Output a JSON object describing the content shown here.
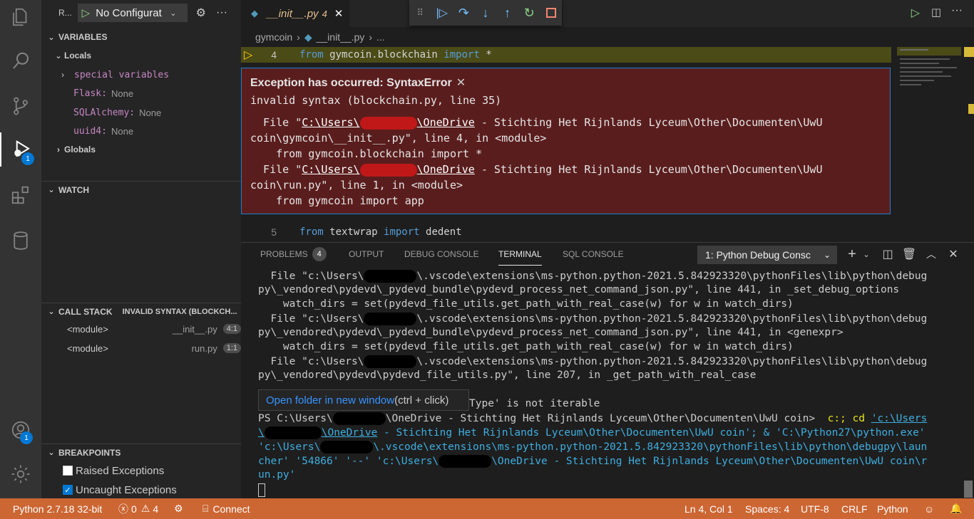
{
  "activity_bar": {
    "debug_badge": "1",
    "accounts_badge": "1"
  },
  "sidebar": {
    "run_label": "R...",
    "config_select": "No Configurat",
    "variables_header": "VARIABLES",
    "locals_label": "Locals",
    "locals_items": [
      {
        "name": "special variables",
        "value": ""
      },
      {
        "name": "Flask:",
        "value": "None"
      },
      {
        "name": "SQLAlchemy:",
        "value": "None"
      },
      {
        "name": "uuid4:",
        "value": "None"
      }
    ],
    "globals_label": "Globals",
    "watch_header": "WATCH",
    "callstack_header": "CALL STACK",
    "callstack_status": "INVALID SYNTAX (BLOCKCH...",
    "callstack_items": [
      {
        "name": "<module>",
        "file": "__init__.py",
        "pos": "4:1"
      },
      {
        "name": "<module>",
        "file": "run.py",
        "pos": "1:1"
      }
    ],
    "breakpoints_header": "BREAKPOINTS",
    "breakpoints": [
      {
        "label": "Raised Exceptions",
        "checked": false
      },
      {
        "label": "Uncaught Exceptions",
        "checked": true
      }
    ]
  },
  "editor": {
    "tab_label": "__init__.py",
    "tab_badge": "4",
    "breadcrumb": {
      "folder": "gymcoin",
      "file": "__init__.py",
      "tail": "..."
    },
    "line4": {
      "num": "4",
      "kw1": "from",
      "mod": " gymcoin.blockchain ",
      "kw2": "import",
      "rest": " *"
    },
    "line5": {
      "num": "5",
      "kw1": "from",
      "mod": " textwrap ",
      "kw2": "import",
      "rest": " dedent"
    },
    "exception": {
      "title": "Exception has occurred: SyntaxError",
      "message": "invalid syntax (blockchain.py, line 35)",
      "tb1_prefix": "  File \"",
      "tb1_link_a": "C:\\Users\\",
      "tb1_link_b": "\\OneDrive",
      "tb1_rest": " - Stichting Het Rijnlands Lyceum\\Other\\Documenten\\UwU",
      "tb1_line2": "coin\\gymcoin\\__init__.py\", line 4, in <module>",
      "tb1_code": "    from gymcoin.blockchain import *",
      "tb2_prefix": "  File \"",
      "tb2_link_a": "C:\\Users\\",
      "tb2_link_b": "\\OneDrive",
      "tb2_rest": " - Stichting Het Rijnlands Lyceum\\Other\\Documenten\\UwU",
      "tb2_line2": "coin\\run.py\", line 1, in <module>",
      "tb2_code": "    from gymcoin import app"
    }
  },
  "panel": {
    "tabs": [
      "PROBLEMS",
      "OUTPUT",
      "DEBUG CONSOLE",
      "TERMINAL",
      "SQL CONSOLE"
    ],
    "problems_badge": "4",
    "terminal_select": "1: Python Debug Consc",
    "terminal_lines": {
      "l1a": "  File \"c:\\Users\\",
      "l1b": "\\.vscode\\extensions\\ms-python.python-2021.5.842923320\\pythonFiles\\lib\\python\\debug",
      "l2": "py\\_vendored\\pydevd\\_pydevd_bundle\\pydevd_process_net_command_json.py\", line 441, in _set_debug_options",
      "l3": "    watch_dirs = set(pydevd_file_utils.get_path_with_real_case(w) for w in watch_dirs)",
      "l4a": "  File \"c:\\Users\\",
      "l4b": "\\.vscode\\extensions\\ms-python.python-2021.5.842923320\\pythonFiles\\lib\\python\\debug",
      "l5": "py\\_vendored\\pydevd\\_pydevd_bundle\\pydevd_process_net_command_json.py\", line 441, in <genexpr>",
      "l6": "    watch_dirs = set(pydevd_file_utils.get_path_with_real_case(w) for w in watch_dirs)",
      "l7a": "  File \"c:\\Users\\",
      "l7b": "\\.vscode\\extensions\\ms-python.python-2021.5.842923320\\pythonFiles\\lib\\python\\debug",
      "l8": "py\\_vendored\\pydevd\\pydevd_file_utils.py\", line 207, in _get_path_with_real_case",
      "l10": "Type' is not iterable",
      "ps_a": "PS C:\\Users\\",
      "ps_b": "\\OneDrive - Stichting Het Rijnlands Lyceum\\Other\\Documenten\\UwU coin> ",
      "ps_cmd": " c:; cd ",
      "ps_link": "'c:\\Users",
      "l12_link": "\\OneDrive",
      "l12_rest": " - Stichting Het Rijnlands Lyceum\\Other\\Documenten\\UwU coin'; & 'C:\\Python27\\python.exe'",
      "l13a": "'c:\\Users\\",
      "l13b": "\\.vscode\\extensions\\ms-python.python-2021.5.842923320\\pythonFiles\\lib\\python\\debugpy\\laun",
      "l14a": "cher' '54866' '--' 'c:\\Users\\",
      "l14b": "\\OneDrive - Stichting Het Rijnlands Lyceum\\Other\\Documenten\\UwU coin\\r",
      "l15": "un.py'"
    },
    "tooltip_link": "Open folder in new window",
    "tooltip_hint": " (ctrl + click)"
  },
  "status": {
    "python": "Python 2.7.18 32-bit",
    "errors": "0",
    "warnings": "4",
    "connect": "Connect",
    "position": "Ln 4, Col 1",
    "spaces": "Spaces: 4",
    "encoding": "UTF-8",
    "eol": "CRLF",
    "language": "Python"
  },
  "colors": {
    "status_bar": "#cc6633",
    "exception_bg": "#5a1d1d",
    "accent": "#0078d4"
  }
}
